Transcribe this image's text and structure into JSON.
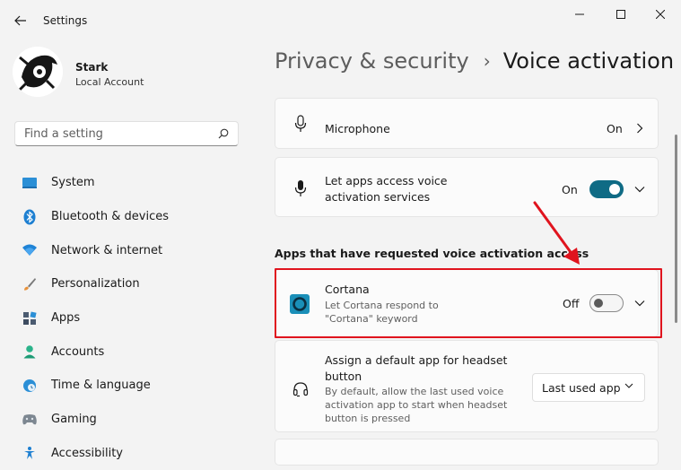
{
  "window": {
    "title": "Settings"
  },
  "user": {
    "name": "Stark",
    "account_type": "Local Account"
  },
  "search": {
    "placeholder": "Find a setting"
  },
  "sidebar": {
    "items": [
      {
        "label": "System",
        "icon": "monitor-icon"
      },
      {
        "label": "Bluetooth & devices",
        "icon": "bluetooth-icon"
      },
      {
        "label": "Network & internet",
        "icon": "wifi-icon"
      },
      {
        "label": "Personalization",
        "icon": "brush-icon"
      },
      {
        "label": "Apps",
        "icon": "apps-icon"
      },
      {
        "label": "Accounts",
        "icon": "person-icon"
      },
      {
        "label": "Time & language",
        "icon": "globe-clock-icon"
      },
      {
        "label": "Gaming",
        "icon": "controller-icon"
      },
      {
        "label": "Accessibility",
        "icon": "accessibility-icon"
      }
    ]
  },
  "breadcrumb": {
    "parent": "Privacy & security",
    "separator": "›",
    "current": "Voice activation"
  },
  "settings": {
    "microphone": {
      "title": "Microphone",
      "state": "On"
    },
    "voice_access": {
      "title_line1": "Let apps access voice",
      "title_line2": "activation services",
      "state": "On",
      "toggle_on": true
    },
    "section_heading": "Apps that have requested voice activation access",
    "cortana": {
      "title": "Cortana",
      "desc_line1": "Let Cortana respond to",
      "desc_line2": "\"Cortana\" keyword",
      "state": "Off",
      "toggle_on": false
    },
    "headset": {
      "title_line1": "Assign a default app for headset",
      "title_line2": "button",
      "desc_line1": "By default, allow the last used voice",
      "desc_line2": "activation app to start when headset",
      "desc_line3": "button is pressed",
      "dropdown_value": "Last used app"
    }
  },
  "colors": {
    "accent": "#0f6b85",
    "highlight": "#e0141e",
    "cortana": "#1a8fb8"
  }
}
